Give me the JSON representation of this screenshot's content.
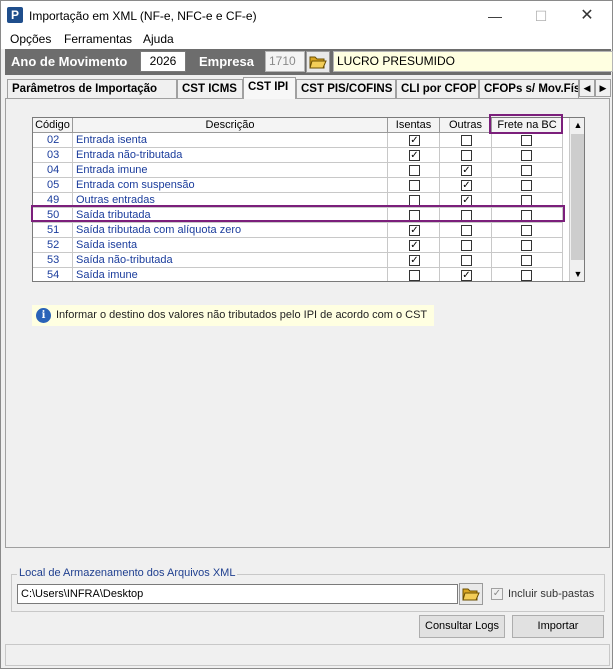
{
  "window": {
    "title": "Importação em XML (NF-e, NFC-e e CF-e)",
    "min": "—",
    "max": "☐",
    "close": "✕"
  },
  "menu": [
    "Opções",
    "Ferramentas",
    "Ajuda"
  ],
  "header": {
    "ano_label": "Ano de Movimento",
    "ano_value": "2026",
    "empresa_label": "Empresa",
    "empresa_code": "1710",
    "empresa_name": "LUCRO PRESUMIDO"
  },
  "tabs": [
    "Parâmetros de Importação",
    "CST ICMS",
    "CST IPI",
    "CST PIS/COFINS",
    "CLI por CFOP",
    "CFOPs s/ Mov.Fís"
  ],
  "active_tab": 2,
  "grid": {
    "columns": [
      "Código",
      "Descrição",
      "Isentas",
      "Outras",
      "Frete na BC"
    ],
    "rows": [
      {
        "code": "02",
        "desc": "Entrada isenta",
        "isentas": true,
        "outras": false,
        "frete": false
      },
      {
        "code": "03",
        "desc": "Entrada não-tributada",
        "isentas": true,
        "outras": false,
        "frete": false
      },
      {
        "code": "04",
        "desc": "Entrada imune",
        "isentas": false,
        "outras": true,
        "frete": false
      },
      {
        "code": "05",
        "desc": "Entrada com suspensão",
        "isentas": false,
        "outras": true,
        "frete": false
      },
      {
        "code": "49",
        "desc": "Outras entradas",
        "isentas": false,
        "outras": true,
        "frete": false
      },
      {
        "code": "50",
        "desc": "Saída tributada",
        "isentas": false,
        "outras": false,
        "frete": false
      },
      {
        "code": "51",
        "desc": "Saída tributada com alíquota zero",
        "isentas": true,
        "outras": false,
        "frete": false
      },
      {
        "code": "52",
        "desc": "Saída isenta",
        "isentas": true,
        "outras": false,
        "frete": false
      },
      {
        "code": "53",
        "desc": "Saída não-tributada",
        "isentas": true,
        "outras": false,
        "frete": false
      },
      {
        "code": "54",
        "desc": "Saída imune",
        "isentas": false,
        "outras": true,
        "frete": false
      }
    ]
  },
  "info_text": "Informar o destino dos valores não tributados pelo IPI de acordo com o CST",
  "storage": {
    "group_title": "Local de Armazenamento dos Arquivos XML",
    "path": "C:\\Users\\INFRA\\Desktop",
    "include_subfolders_label": "Incluir sub-pastas",
    "include_subfolders": true
  },
  "buttons": {
    "logs": "Consultar Logs",
    "import": "Importar"
  },
  "colors": {
    "header_bg": "#6d6d6d",
    "highlight": "#7b1f7b",
    "link_text": "#1a3c9c",
    "info_bg": "#ffffe1"
  }
}
